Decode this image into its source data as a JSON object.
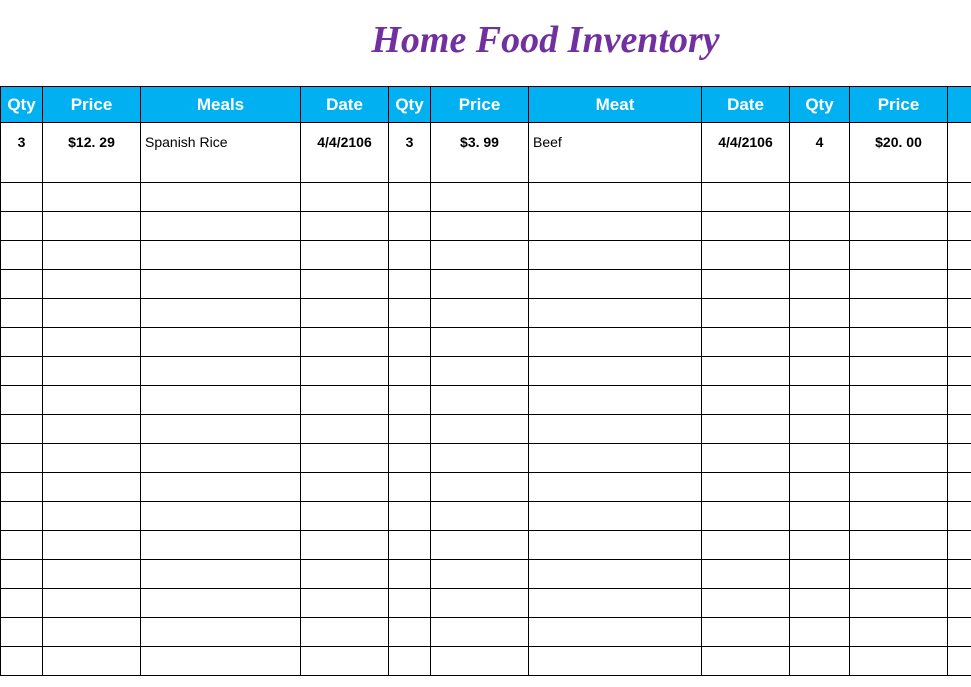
{
  "title": "Home Food Inventory",
  "headers": {
    "qty1": "Qty",
    "price1": "Price",
    "meals": "Meals",
    "date1": "Date",
    "qty2": "Qty",
    "price2": "Price",
    "meat": "Meat",
    "date2": "Date",
    "qty3": "Qty",
    "price3": "Price"
  },
  "row": {
    "qty1": "3",
    "price1": "$12. 29",
    "meals": "Spanish Rice",
    "date1": "4/4/2106",
    "qty2": "3",
    "price2": "$3. 99",
    "meat": "Beef",
    "date2": "4/4/2106",
    "qty3": "4",
    "price3": "$20. 00"
  },
  "empty_rows": 17
}
